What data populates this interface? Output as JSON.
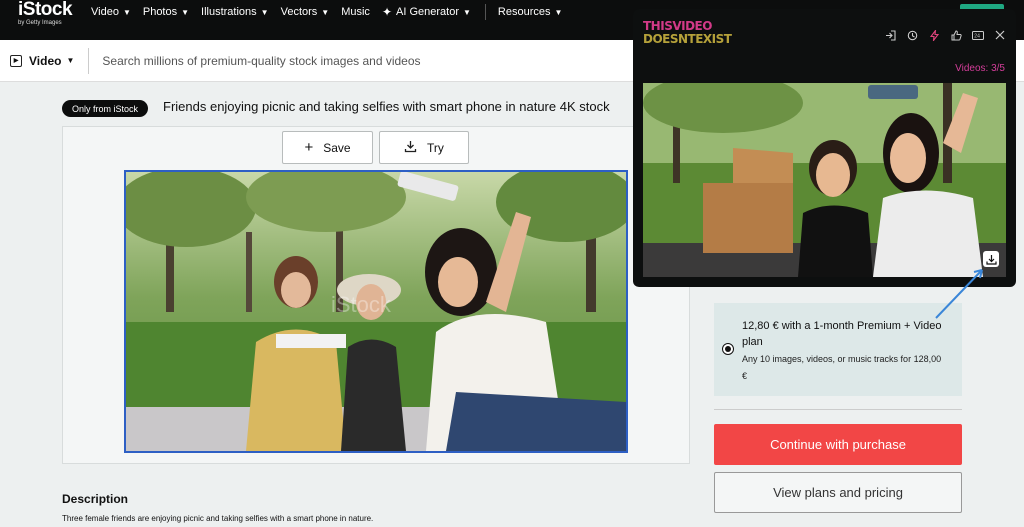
{
  "nav": {
    "logo": "iStock",
    "logo_sub": "by Getty Images",
    "items": [
      {
        "label": "Video"
      },
      {
        "label": "Photos"
      },
      {
        "label": "Illustrations"
      },
      {
        "label": "Vectors"
      }
    ],
    "music": "Music",
    "ai_generator": "AI Generator",
    "resources": "Resources"
  },
  "search": {
    "media_type": "Video",
    "placeholder": "Search millions of premium-quality stock images and videos"
  },
  "asset": {
    "badge": "Only from iStock",
    "title": "Friends enjoying picnic and taking selfies with smart phone in nature 4K stock",
    "save_label": "Save",
    "try_label": "Try",
    "watermark": "iStock"
  },
  "description": {
    "heading": "Description",
    "text": "Three female friends are enjoying picnic and taking selfies with a smart phone in nature."
  },
  "pricing": {
    "main": "12,80 € with a 1-month Premium + Video plan",
    "sub": "Any 10 images, videos, or music tracks for 128,00 €",
    "purchase_label": "Continue with purchase",
    "plans_label": "View plans and pricing"
  },
  "overlay": {
    "logo_line1": "THISVIDEO",
    "logo_line2": "DOESNTEXIST",
    "counter": "Videos: 3/5",
    "icons": [
      "enter-icon",
      "history-icon",
      "bolt-icon",
      "thumbs-up-icon",
      "hd-icon",
      "close-icon"
    ]
  },
  "colors": {
    "accent_red": "#f24646",
    "selection_blue": "#2d5fc4",
    "overlay_pink": "#d23a88",
    "overlay_gold": "#b5a13a"
  }
}
